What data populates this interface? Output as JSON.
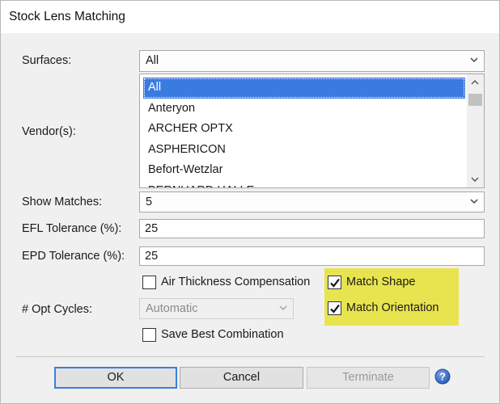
{
  "window": {
    "title": "Stock Lens Matching"
  },
  "surfaces": {
    "label": "Surfaces:",
    "value": "All"
  },
  "vendors": {
    "label": "Vendor(s):",
    "items": [
      "All",
      "Anteryon",
      "ARCHER OPTX",
      "ASPHERICON",
      "Befort-Wetzlar",
      "BERNHARD HALLE"
    ],
    "selected": "All"
  },
  "show_matches": {
    "label": "Show Matches:",
    "value": "5"
  },
  "efl_tolerance": {
    "label": "EFL Tolerance (%):",
    "value": "25"
  },
  "epd_tolerance": {
    "label": "EPD Tolerance (%):",
    "value": "25"
  },
  "air_thickness": {
    "label": "Air Thickness Compensation",
    "checked": false
  },
  "match_shape": {
    "label": "Match Shape",
    "checked": true
  },
  "match_orientation": {
    "label": "Match Orientation",
    "checked": true
  },
  "opt_cycles": {
    "label": "# Opt Cycles:",
    "value": "Automatic"
  },
  "save_best": {
    "label": "Save Best Combination",
    "checked": false
  },
  "buttons": {
    "ok": "OK",
    "cancel": "Cancel",
    "terminate": "Terminate"
  },
  "icons": {
    "help": "help-icon",
    "dropdown": "chevron-down-icon",
    "check": "checkmark-icon"
  },
  "colors": {
    "selection": "#3a7be0",
    "highlight": "#e8e44f",
    "default_button_border": "#3c7fd6"
  }
}
